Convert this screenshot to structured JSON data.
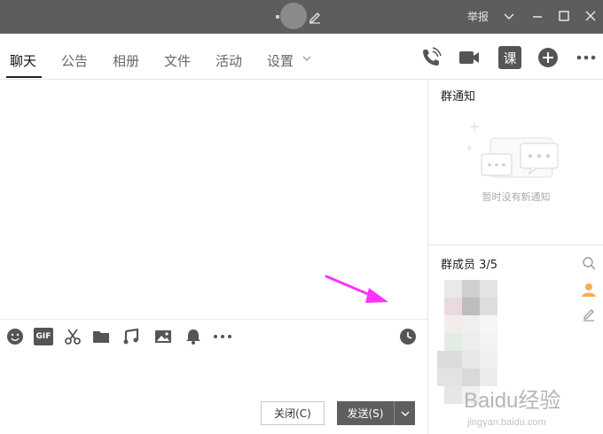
{
  "titlebar": {
    "report_label": "举报",
    "icons": [
      "edit-icon",
      "dropdown-icon",
      "minimize-icon",
      "maximize-icon",
      "close-icon"
    ]
  },
  "tabs": [
    {
      "label": "聊天",
      "active": true
    },
    {
      "label": "公告",
      "active": false
    },
    {
      "label": "相册",
      "active": false
    },
    {
      "label": "文件",
      "active": false
    },
    {
      "label": "活动",
      "active": false
    },
    {
      "label": "设置",
      "active": false
    }
  ],
  "toolbar": {
    "icons": [
      "phone-icon",
      "video-icon",
      "lesson-icon",
      "add-circle-icon",
      "more-icon"
    ],
    "lesson_glyph": "课"
  },
  "composer": {
    "tools": [
      "emoji-icon",
      "gif-icon",
      "scissors-icon",
      "folder-icon",
      "music-icon",
      "image-icon",
      "bell-icon",
      "more-icon",
      "history-icon"
    ],
    "gif_glyph": "GIF"
  },
  "buttons": {
    "close_label": "关闭(C)",
    "send_label": "发送(S)"
  },
  "right_panel": {
    "notice_title": "群通知",
    "notice_empty": "暂时没有新通知",
    "members_title": "群成员 3/5"
  },
  "watermark": {
    "text": "Baidu经验",
    "url": "jingyan.baidu.com"
  },
  "colors": {
    "titlebar_bg": "#5d5d5d",
    "send_button_bg": "#5e5e5e",
    "annotation_arrow": "#ff33ff",
    "icon_gray": "#555555"
  }
}
